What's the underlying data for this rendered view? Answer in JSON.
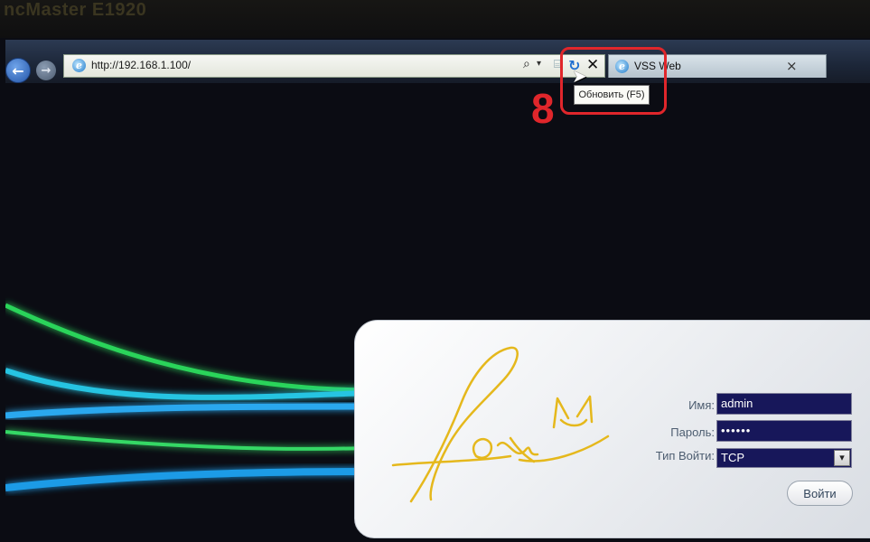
{
  "monitor": {
    "brand": "ncMaster E1920"
  },
  "browser": {
    "address": {
      "url": "http://192.168.1.100/"
    },
    "icons": {
      "back": "back-arrow-icon",
      "forward": "forward-arrow-icon",
      "site": "ie-icon",
      "search": "search-icon",
      "refresh": "refresh-icon",
      "stop": "stop-icon"
    },
    "search_symbol": "⌕",
    "dropdown_symbol": "▾",
    "compat_symbol": "⌸",
    "refresh_symbol": "↻",
    "stop_symbol": "✕",
    "back_symbol": "←",
    "forward_symbol": "→",
    "ie_symbol": "e",
    "tab": {
      "title": "VSS Web",
      "close_symbol": "×"
    },
    "tooltip": "Обновить (F5)"
  },
  "annotation": {
    "step": "8",
    "color": "#e0262b"
  },
  "login": {
    "username_label": "Имя:",
    "username_value": "admin",
    "password_label": "Пароль:",
    "password_value": "••••••",
    "type_label": "Тип Войти:",
    "type_value": "TCP",
    "type_arrow": "▾",
    "submit_label": "Войти",
    "field_color": "#17175a"
  },
  "logo": {
    "text": "fox",
    "color": "#e5b81c"
  }
}
